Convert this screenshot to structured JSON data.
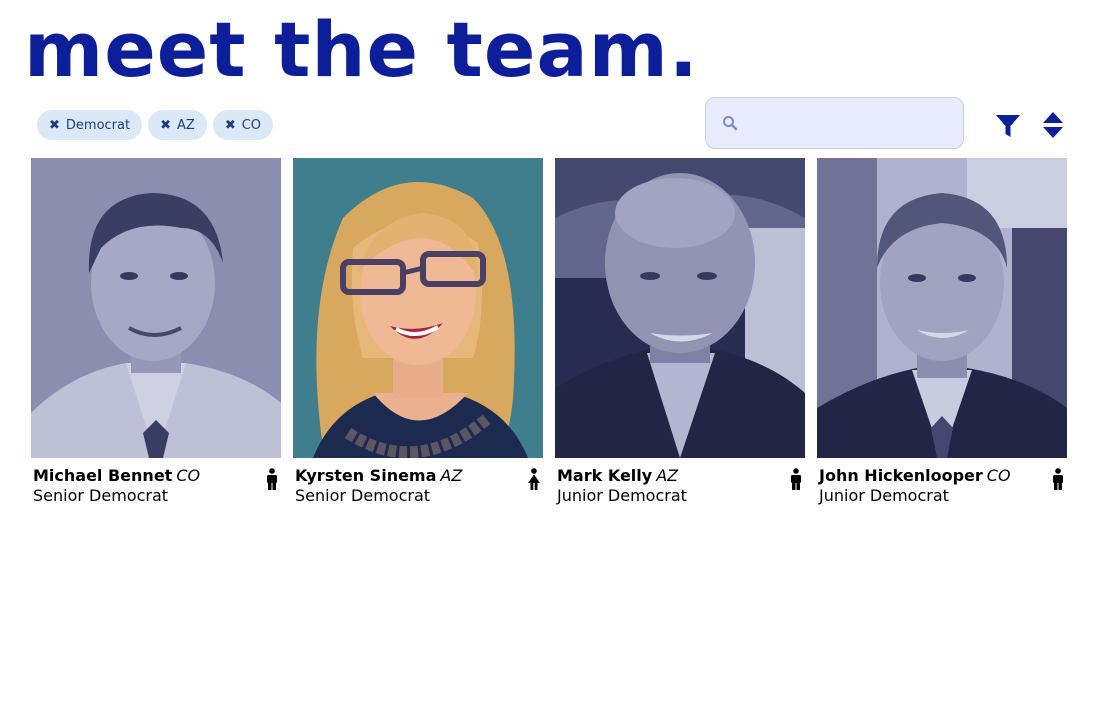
{
  "header": {
    "title": "meet the team."
  },
  "filters": {
    "chips": [
      {
        "label": "Democrat"
      },
      {
        "label": "AZ"
      },
      {
        "label": "CO"
      }
    ],
    "remove_icon": "close-icon"
  },
  "search": {
    "value": "",
    "placeholder": "",
    "icon": "search-icon"
  },
  "toolbar": {
    "filter_icon": "filter-icon",
    "sort_icon": "sort-icon"
  },
  "colors": {
    "brand": "#0c1f99",
    "chip_bg": "#dbe8f5",
    "search_bg": "#e8ebfb"
  },
  "members": [
    {
      "name": "Michael Bennet",
      "state": "CO",
      "role": "Senior Democrat",
      "gender_icon": "male-icon"
    },
    {
      "name": "Kyrsten Sinema",
      "state": "AZ",
      "role": "Senior Democrat",
      "gender_icon": "female-icon"
    },
    {
      "name": "Mark Kelly",
      "state": "AZ",
      "role": "Junior Democrat",
      "gender_icon": "male-icon"
    },
    {
      "name": "John Hickenlooper",
      "state": "CO",
      "role": "Junior Democrat",
      "gender_icon": "male-icon"
    }
  ]
}
